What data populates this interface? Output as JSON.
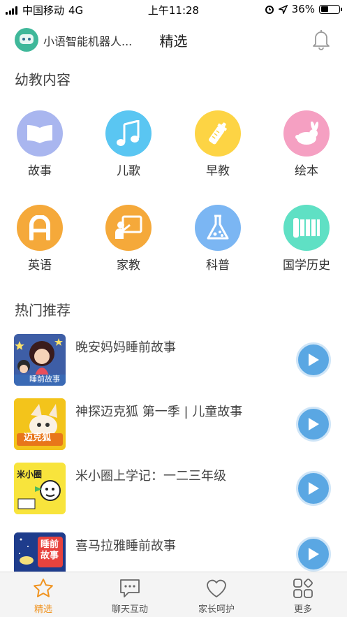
{
  "status_bar": {
    "carrier": "中国移动",
    "network": "4G",
    "time": "上午11:28",
    "battery": "36%"
  },
  "header": {
    "device_name": "小语智能机器人...",
    "title": "精选"
  },
  "section_kids": {
    "title": "幼教内容"
  },
  "categories": [
    {
      "label": "故事",
      "icon": "book-icon",
      "color": "#a9b6ef"
    },
    {
      "label": "儿歌",
      "icon": "music-note-icon",
      "color": "#5ac6f2"
    },
    {
      "label": "早教",
      "icon": "baby-bottle-icon",
      "color": "#fdd444"
    },
    {
      "label": "绘本",
      "icon": "rabbit-icon",
      "color": "#f5a0c2"
    },
    {
      "label": "英语",
      "icon": "letter-a-icon",
      "color": "#f5a93a"
    },
    {
      "label": "家教",
      "icon": "teacher-board-icon",
      "color": "#f5a93a"
    },
    {
      "label": "科普",
      "icon": "flask-icon",
      "color": "#7bb6f3"
    },
    {
      "label": "国学历史",
      "icon": "bamboo-scroll-icon",
      "color": "#5fe0c4"
    }
  ],
  "section_hot": {
    "title": "热门推荐"
  },
  "recommendations": [
    {
      "title": "晚安妈妈睡前故事",
      "cover_text": "睡前故事"
    },
    {
      "title": "神探迈克狐 第一季 | 儿童故事",
      "cover_text": "迈克狐"
    },
    {
      "title": "米小圈上学记：一二三年级",
      "cover_text": "米小圈"
    },
    {
      "title": "喜马拉雅睡前故事",
      "cover_text": "睡前故事"
    }
  ],
  "tabs": [
    {
      "label": "精选",
      "icon": "star-icon",
      "active": true
    },
    {
      "label": "聊天互动",
      "icon": "chat-bubble-icon",
      "active": false
    },
    {
      "label": "家长呵护",
      "icon": "heart-icon",
      "active": false
    },
    {
      "label": "更多",
      "icon": "grid-more-icon",
      "active": false
    }
  ],
  "colors": {
    "accent": "#f0931f",
    "play": "#5aa7e3"
  }
}
